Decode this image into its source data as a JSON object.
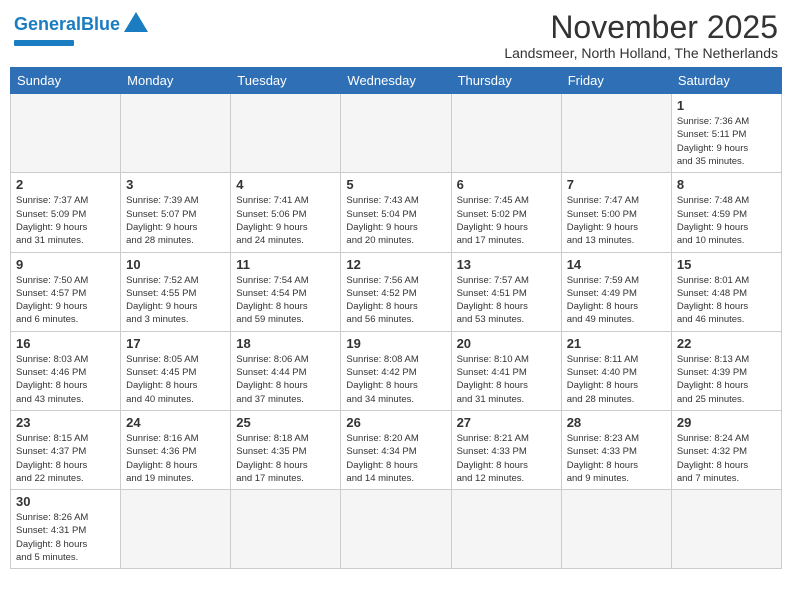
{
  "header": {
    "logo_general": "General",
    "logo_blue": "Blue",
    "month_title": "November 2025",
    "location": "Landsmeer, North Holland, The Netherlands"
  },
  "weekdays": [
    "Sunday",
    "Monday",
    "Tuesday",
    "Wednesday",
    "Thursday",
    "Friday",
    "Saturday"
  ],
  "weeks": [
    [
      {
        "day": "",
        "info": ""
      },
      {
        "day": "",
        "info": ""
      },
      {
        "day": "",
        "info": ""
      },
      {
        "day": "",
        "info": ""
      },
      {
        "day": "",
        "info": ""
      },
      {
        "day": "",
        "info": ""
      },
      {
        "day": "1",
        "info": "Sunrise: 7:36 AM\nSunset: 5:11 PM\nDaylight: 9 hours\nand 35 minutes."
      }
    ],
    [
      {
        "day": "2",
        "info": "Sunrise: 7:37 AM\nSunset: 5:09 PM\nDaylight: 9 hours\nand 31 minutes."
      },
      {
        "day": "3",
        "info": "Sunrise: 7:39 AM\nSunset: 5:07 PM\nDaylight: 9 hours\nand 28 minutes."
      },
      {
        "day": "4",
        "info": "Sunrise: 7:41 AM\nSunset: 5:06 PM\nDaylight: 9 hours\nand 24 minutes."
      },
      {
        "day": "5",
        "info": "Sunrise: 7:43 AM\nSunset: 5:04 PM\nDaylight: 9 hours\nand 20 minutes."
      },
      {
        "day": "6",
        "info": "Sunrise: 7:45 AM\nSunset: 5:02 PM\nDaylight: 9 hours\nand 17 minutes."
      },
      {
        "day": "7",
        "info": "Sunrise: 7:47 AM\nSunset: 5:00 PM\nDaylight: 9 hours\nand 13 minutes."
      },
      {
        "day": "8",
        "info": "Sunrise: 7:48 AM\nSunset: 4:59 PM\nDaylight: 9 hours\nand 10 minutes."
      }
    ],
    [
      {
        "day": "9",
        "info": "Sunrise: 7:50 AM\nSunset: 4:57 PM\nDaylight: 9 hours\nand 6 minutes."
      },
      {
        "day": "10",
        "info": "Sunrise: 7:52 AM\nSunset: 4:55 PM\nDaylight: 9 hours\nand 3 minutes."
      },
      {
        "day": "11",
        "info": "Sunrise: 7:54 AM\nSunset: 4:54 PM\nDaylight: 8 hours\nand 59 minutes."
      },
      {
        "day": "12",
        "info": "Sunrise: 7:56 AM\nSunset: 4:52 PM\nDaylight: 8 hours\nand 56 minutes."
      },
      {
        "day": "13",
        "info": "Sunrise: 7:57 AM\nSunset: 4:51 PM\nDaylight: 8 hours\nand 53 minutes."
      },
      {
        "day": "14",
        "info": "Sunrise: 7:59 AM\nSunset: 4:49 PM\nDaylight: 8 hours\nand 49 minutes."
      },
      {
        "day": "15",
        "info": "Sunrise: 8:01 AM\nSunset: 4:48 PM\nDaylight: 8 hours\nand 46 minutes."
      }
    ],
    [
      {
        "day": "16",
        "info": "Sunrise: 8:03 AM\nSunset: 4:46 PM\nDaylight: 8 hours\nand 43 minutes."
      },
      {
        "day": "17",
        "info": "Sunrise: 8:05 AM\nSunset: 4:45 PM\nDaylight: 8 hours\nand 40 minutes."
      },
      {
        "day": "18",
        "info": "Sunrise: 8:06 AM\nSunset: 4:44 PM\nDaylight: 8 hours\nand 37 minutes."
      },
      {
        "day": "19",
        "info": "Sunrise: 8:08 AM\nSunset: 4:42 PM\nDaylight: 8 hours\nand 34 minutes."
      },
      {
        "day": "20",
        "info": "Sunrise: 8:10 AM\nSunset: 4:41 PM\nDaylight: 8 hours\nand 31 minutes."
      },
      {
        "day": "21",
        "info": "Sunrise: 8:11 AM\nSunset: 4:40 PM\nDaylight: 8 hours\nand 28 minutes."
      },
      {
        "day": "22",
        "info": "Sunrise: 8:13 AM\nSunset: 4:39 PM\nDaylight: 8 hours\nand 25 minutes."
      }
    ],
    [
      {
        "day": "23",
        "info": "Sunrise: 8:15 AM\nSunset: 4:37 PM\nDaylight: 8 hours\nand 22 minutes."
      },
      {
        "day": "24",
        "info": "Sunrise: 8:16 AM\nSunset: 4:36 PM\nDaylight: 8 hours\nand 19 minutes."
      },
      {
        "day": "25",
        "info": "Sunrise: 8:18 AM\nSunset: 4:35 PM\nDaylight: 8 hours\nand 17 minutes."
      },
      {
        "day": "26",
        "info": "Sunrise: 8:20 AM\nSunset: 4:34 PM\nDaylight: 8 hours\nand 14 minutes."
      },
      {
        "day": "27",
        "info": "Sunrise: 8:21 AM\nSunset: 4:33 PM\nDaylight: 8 hours\nand 12 minutes."
      },
      {
        "day": "28",
        "info": "Sunrise: 8:23 AM\nSunset: 4:33 PM\nDaylight: 8 hours\nand 9 minutes."
      },
      {
        "day": "29",
        "info": "Sunrise: 8:24 AM\nSunset: 4:32 PM\nDaylight: 8 hours\nand 7 minutes."
      }
    ],
    [
      {
        "day": "30",
        "info": "Sunrise: 8:26 AM\nSunset: 4:31 PM\nDaylight: 8 hours\nand 5 minutes."
      },
      {
        "day": "",
        "info": ""
      },
      {
        "day": "",
        "info": ""
      },
      {
        "day": "",
        "info": ""
      },
      {
        "day": "",
        "info": ""
      },
      {
        "day": "",
        "info": ""
      },
      {
        "day": "",
        "info": ""
      }
    ]
  ]
}
